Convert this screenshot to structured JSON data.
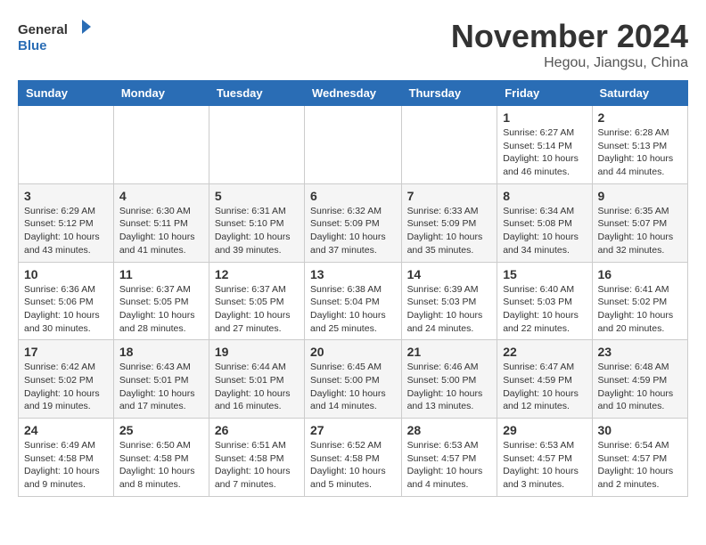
{
  "header": {
    "logo_line1": "General",
    "logo_line2": "Blue",
    "month": "November 2024",
    "location": "Hegou, Jiangsu, China"
  },
  "weekdays": [
    "Sunday",
    "Monday",
    "Tuesday",
    "Wednesday",
    "Thursday",
    "Friday",
    "Saturday"
  ],
  "weeks": [
    [
      {
        "day": "",
        "info": ""
      },
      {
        "day": "",
        "info": ""
      },
      {
        "day": "",
        "info": ""
      },
      {
        "day": "",
        "info": ""
      },
      {
        "day": "",
        "info": ""
      },
      {
        "day": "1",
        "info": "Sunrise: 6:27 AM\nSunset: 5:14 PM\nDaylight: 10 hours\nand 46 minutes."
      },
      {
        "day": "2",
        "info": "Sunrise: 6:28 AM\nSunset: 5:13 PM\nDaylight: 10 hours\nand 44 minutes."
      }
    ],
    [
      {
        "day": "3",
        "info": "Sunrise: 6:29 AM\nSunset: 5:12 PM\nDaylight: 10 hours\nand 43 minutes."
      },
      {
        "day": "4",
        "info": "Sunrise: 6:30 AM\nSunset: 5:11 PM\nDaylight: 10 hours\nand 41 minutes."
      },
      {
        "day": "5",
        "info": "Sunrise: 6:31 AM\nSunset: 5:10 PM\nDaylight: 10 hours\nand 39 minutes."
      },
      {
        "day": "6",
        "info": "Sunrise: 6:32 AM\nSunset: 5:09 PM\nDaylight: 10 hours\nand 37 minutes."
      },
      {
        "day": "7",
        "info": "Sunrise: 6:33 AM\nSunset: 5:09 PM\nDaylight: 10 hours\nand 35 minutes."
      },
      {
        "day": "8",
        "info": "Sunrise: 6:34 AM\nSunset: 5:08 PM\nDaylight: 10 hours\nand 34 minutes."
      },
      {
        "day": "9",
        "info": "Sunrise: 6:35 AM\nSunset: 5:07 PM\nDaylight: 10 hours\nand 32 minutes."
      }
    ],
    [
      {
        "day": "10",
        "info": "Sunrise: 6:36 AM\nSunset: 5:06 PM\nDaylight: 10 hours\nand 30 minutes."
      },
      {
        "day": "11",
        "info": "Sunrise: 6:37 AM\nSunset: 5:05 PM\nDaylight: 10 hours\nand 28 minutes."
      },
      {
        "day": "12",
        "info": "Sunrise: 6:37 AM\nSunset: 5:05 PM\nDaylight: 10 hours\nand 27 minutes."
      },
      {
        "day": "13",
        "info": "Sunrise: 6:38 AM\nSunset: 5:04 PM\nDaylight: 10 hours\nand 25 minutes."
      },
      {
        "day": "14",
        "info": "Sunrise: 6:39 AM\nSunset: 5:03 PM\nDaylight: 10 hours\nand 24 minutes."
      },
      {
        "day": "15",
        "info": "Sunrise: 6:40 AM\nSunset: 5:03 PM\nDaylight: 10 hours\nand 22 minutes."
      },
      {
        "day": "16",
        "info": "Sunrise: 6:41 AM\nSunset: 5:02 PM\nDaylight: 10 hours\nand 20 minutes."
      }
    ],
    [
      {
        "day": "17",
        "info": "Sunrise: 6:42 AM\nSunset: 5:02 PM\nDaylight: 10 hours\nand 19 minutes."
      },
      {
        "day": "18",
        "info": "Sunrise: 6:43 AM\nSunset: 5:01 PM\nDaylight: 10 hours\nand 17 minutes."
      },
      {
        "day": "19",
        "info": "Sunrise: 6:44 AM\nSunset: 5:01 PM\nDaylight: 10 hours\nand 16 minutes."
      },
      {
        "day": "20",
        "info": "Sunrise: 6:45 AM\nSunset: 5:00 PM\nDaylight: 10 hours\nand 14 minutes."
      },
      {
        "day": "21",
        "info": "Sunrise: 6:46 AM\nSunset: 5:00 PM\nDaylight: 10 hours\nand 13 minutes."
      },
      {
        "day": "22",
        "info": "Sunrise: 6:47 AM\nSunset: 4:59 PM\nDaylight: 10 hours\nand 12 minutes."
      },
      {
        "day": "23",
        "info": "Sunrise: 6:48 AM\nSunset: 4:59 PM\nDaylight: 10 hours\nand 10 minutes."
      }
    ],
    [
      {
        "day": "24",
        "info": "Sunrise: 6:49 AM\nSunset: 4:58 PM\nDaylight: 10 hours\nand 9 minutes."
      },
      {
        "day": "25",
        "info": "Sunrise: 6:50 AM\nSunset: 4:58 PM\nDaylight: 10 hours\nand 8 minutes."
      },
      {
        "day": "26",
        "info": "Sunrise: 6:51 AM\nSunset: 4:58 PM\nDaylight: 10 hours\nand 7 minutes."
      },
      {
        "day": "27",
        "info": "Sunrise: 6:52 AM\nSunset: 4:58 PM\nDaylight: 10 hours\nand 5 minutes."
      },
      {
        "day": "28",
        "info": "Sunrise: 6:53 AM\nSunset: 4:57 PM\nDaylight: 10 hours\nand 4 minutes."
      },
      {
        "day": "29",
        "info": "Sunrise: 6:53 AM\nSunset: 4:57 PM\nDaylight: 10 hours\nand 3 minutes."
      },
      {
        "day": "30",
        "info": "Sunrise: 6:54 AM\nSunset: 4:57 PM\nDaylight: 10 hours\nand 2 minutes."
      }
    ]
  ]
}
